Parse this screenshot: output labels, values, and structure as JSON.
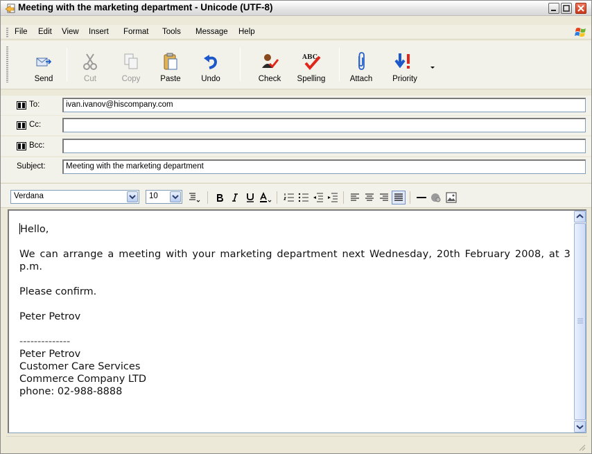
{
  "window": {
    "title": "Meeting with the marketing department - Unicode (UTF-8)"
  },
  "menu": [
    "File",
    "Edit",
    "View",
    "Insert",
    "Format",
    "Tools",
    "Message",
    "Help"
  ],
  "toolbar": {
    "send": "Send",
    "cut": "Cut",
    "copy": "Copy",
    "paste": "Paste",
    "undo": "Undo",
    "check": "Check",
    "spelling": "Spelling",
    "attach": "Attach",
    "priority": "Priority"
  },
  "header": {
    "to_label": "To:",
    "to_value": "ivan.ivanov@hiscompany.com",
    "cc_label": "Cc:",
    "cc_value": "",
    "bcc_label": "Bcc:",
    "bcc_value": "",
    "subject_label": "Subject:",
    "subject_value": "Meeting with the marketing department"
  },
  "format": {
    "font": "Verdana",
    "size": "10",
    "spelling_icon_text": "ABC"
  },
  "message": {
    "greeting": "Hello,",
    "paragraph1": "We can arrange a meeting with your marketing department next Wednesday, 20th February 2008, at 3 p.m.",
    "paragraph2": "Please confirm.",
    "sign_name": "Peter Petrov",
    "divider": "--------------",
    "sig_name": "Peter Petrov",
    "sig_dept": "Customer Care Services",
    "sig_company": "Commerce Company LTD",
    "sig_phone": "phone: 02-988-8888"
  },
  "colors": {
    "window_bg": "#ece9d8",
    "toolbar_bg": "#f3f2ea",
    "input_border": "#7f9db9",
    "scroll_blue": "#c4d5f5"
  }
}
